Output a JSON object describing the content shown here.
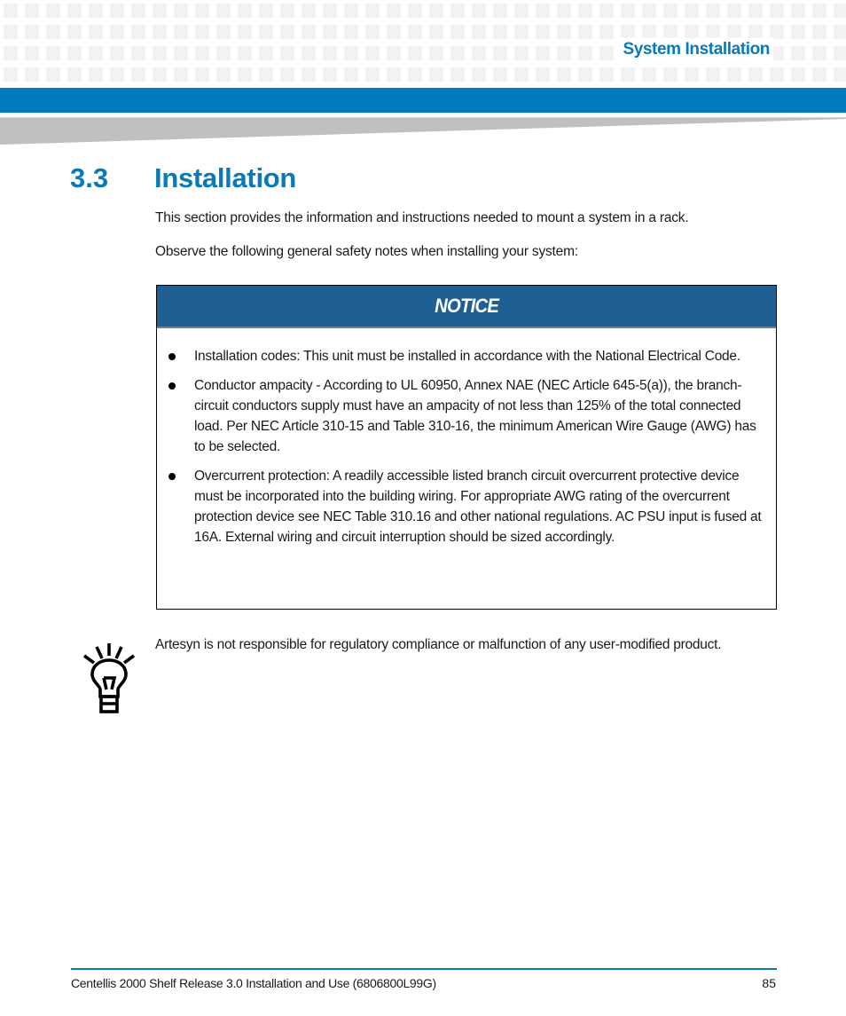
{
  "header": {
    "chapter_title": "System Installation",
    "colors": {
      "accent_blue": "#007bbd",
      "title_blue": "#0a79b8",
      "grid_gray": "#f3f3f3",
      "wedge_gray": "#bfc0c1"
    }
  },
  "section": {
    "number": "3.3",
    "title": "Installation",
    "paragraphs": [
      "This section provides the information and instructions needed to mount a system in a rack.",
      "Observe the following general safety notes when installing your system:"
    ]
  },
  "notice": {
    "label": "NOTICE",
    "header_color": "#1f5f94",
    "items": [
      "Installation codes: This unit must be installed in accordance with the National Electrical Code.",
      "Conductor ampacity - According to UL 60950, Annex NAE (NEC Article 645-5(a)), the branch-circuit conductors supply must have an ampacity of not less than 125% of the total connected load. Per NEC Article 310-15 and Table 310-16, the minimum American Wire Gauge (AWG) has to be selected.",
      "Overcurrent protection: A readily accessible listed branch circuit overcurrent protective device must be incorporated into the building wiring. For appropriate AWG rating of the overcurrent protection device see NEC Table 310.16 and other national regulations. AC PSU input is fused at 16A. External wiring and circuit interruption should be sized accordingly."
    ]
  },
  "tip": {
    "icon": "lightbulb-icon",
    "text": "Artesyn is not responsible for regulatory compliance or malfunction of any user-modified product."
  },
  "footer": {
    "document_title": "Centellis 2000 Shelf Release 3.0 Installation and Use (6806800L99G)",
    "page_number": "85"
  }
}
